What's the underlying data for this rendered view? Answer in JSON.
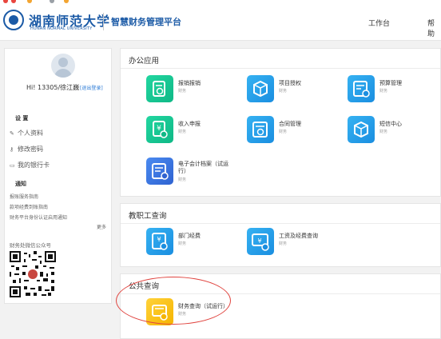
{
  "header": {
    "logo_cn": "湖南师范大学",
    "logo_en": "HUNAN NORMAL UNIVERSITY",
    "platform_title": "智慧财务管理平台",
    "nav": [
      "工作台",
      "帮助"
    ]
  },
  "sidebar": {
    "greeting": "Hi!  13305/徐江巍",
    "logout_label": "[退出登录]",
    "settings_title": "设 置",
    "settings_items": [
      {
        "icon": "edit-icon",
        "label": "个人资料"
      },
      {
        "icon": "key-icon",
        "label": "修改密码"
      },
      {
        "icon": "card-icon",
        "label": "我的银行卡"
      }
    ],
    "notice_title": "通知",
    "notices": [
      "报账服务指南",
      "款项经费到账指南",
      "财务平台身份认证启用通知"
    ],
    "more_label": "更多",
    "wechat_label": "财务处微信公众号"
  },
  "panels": [
    {
      "title": "办公应用",
      "apps": [
        {
          "name": "报销报销",
          "sub": "财务",
          "color": "green",
          "icon": "reimburse-icon"
        },
        {
          "name": "项目授权",
          "sub": "财务",
          "color": "blue",
          "icon": "cube-icon"
        },
        {
          "name": "预算管理",
          "sub": "财务",
          "color": "blue",
          "icon": "budget-icon"
        },
        {
          "name": "收入申报",
          "sub": "财务",
          "color": "green",
          "icon": "income-icon"
        },
        {
          "name": "合同管理",
          "sub": "财务",
          "color": "blue",
          "icon": "contract-icon"
        },
        {
          "name": "短信中心",
          "sub": "财务",
          "color": "blue",
          "icon": "cube-icon"
        },
        {
          "name": "电子会计档案（试运行）",
          "sub": "财务",
          "color": "navy",
          "icon": "archive-icon"
        }
      ]
    },
    {
      "title": "教职工查询",
      "apps": [
        {
          "name": "部门经费",
          "sub": "财务",
          "color": "blue",
          "icon": "dept-fund-icon"
        },
        {
          "name": "工资及经费查询",
          "sub": "财务",
          "color": "blue",
          "icon": "salary-icon"
        }
      ]
    },
    {
      "title": "公共查询",
      "apps": [
        {
          "name": "财务查询（试运行）",
          "sub": "财务",
          "color": "yellow",
          "icon": "finance-query-icon"
        }
      ]
    }
  ]
}
